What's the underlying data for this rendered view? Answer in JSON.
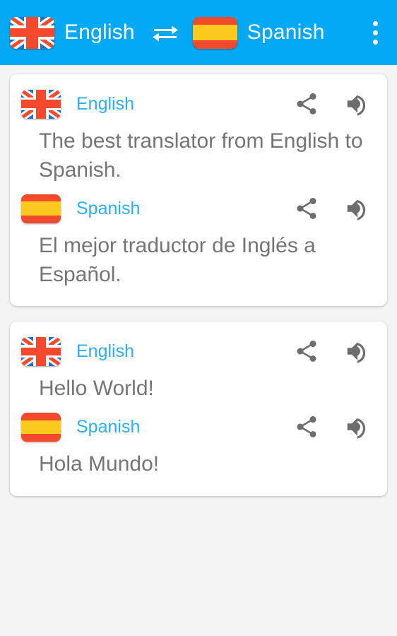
{
  "appbar": {
    "source_flag_icon": "uk-flag-icon",
    "source_language": "English",
    "swap_icon": "swap-horizontal-icon",
    "target_flag_icon": "spain-flag-icon",
    "target_language": "Spanish",
    "overflow_icon": "more-vertical-icon",
    "background_color": "#03a9f4",
    "text_color": "#ffffff"
  },
  "colors": {
    "accent": "#03a9f4",
    "language_label": "#29b0f2",
    "body_text": "#757575",
    "page_background": "#f4f4f4",
    "card_background": "#ffffff",
    "flag_red": "#f4492c",
    "flag_yellow": "#fbca1c",
    "flag_blue": "#1e6fd9"
  },
  "icons": {
    "share": "share-icon",
    "speak": "volume-up-icon"
  },
  "cards": [
    {
      "segments": [
        {
          "flag": "uk-flag-icon",
          "language": "English",
          "text": "The best translator from English to Spanish.",
          "share_label": "Share",
          "speak_label": "Listen"
        },
        {
          "flag": "spain-flag-icon",
          "language": "Spanish",
          "text": "El mejor traductor de Inglés a Español.",
          "share_label": "Share",
          "speak_label": "Listen"
        }
      ]
    },
    {
      "segments": [
        {
          "flag": "uk-flag-icon",
          "language": "English",
          "text": "Hello World!",
          "share_label": "Share",
          "speak_label": "Listen"
        },
        {
          "flag": "spain-flag-icon",
          "language": "Spanish",
          "text": "Hola Mundo!",
          "share_label": "Share",
          "speak_label": "Listen"
        }
      ]
    }
  ]
}
